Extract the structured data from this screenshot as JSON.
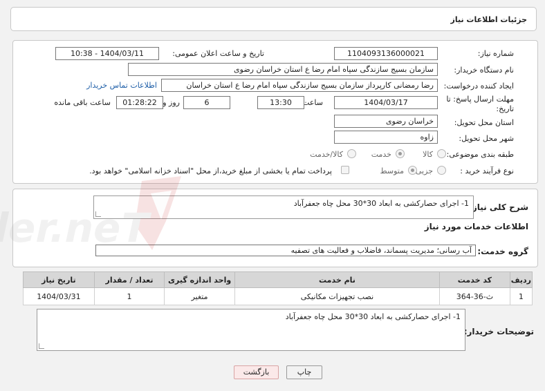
{
  "header": {
    "title": "جزئیات اطلاعات نیاز"
  },
  "form": {
    "need_number": {
      "label": "شماره نیاز:",
      "value": "1104093136000021"
    },
    "announce": {
      "label": "تاریخ و ساعت اعلان عمومی:",
      "value": "1404/03/11 - 10:38"
    },
    "buyer_org": {
      "label": "نام دستگاه خریدار:",
      "value": "سازمان بسیج سازندگی سپاه امام رضا  ع  استان خراسان رضوی"
    },
    "creator": {
      "label": "ایجاد کننده درخواست:",
      "value": "رضا رمضانی کارپرداز سازمان بسیج سازندگی سپاه امام رضا  ع  استان خراسان",
      "contact_link": "اطلاعات تماس خریدار"
    },
    "deadline": {
      "label_line1": "مهلت ارسال پاسخ: تا",
      "label_line2": "تاریخ:",
      "date": "1404/03/17",
      "time_label": "ساعت",
      "time": "13:30",
      "days": "6",
      "days_label": "روز و",
      "remaining": "01:28:22",
      "remaining_label": "ساعت باقی مانده"
    },
    "province": {
      "label": "استان محل تحویل:",
      "value": "خراسان رضوی"
    },
    "city": {
      "label": "شهر محل تحویل:",
      "value": "زاوه"
    },
    "category": {
      "label": "طبقه بندی موضوعی:",
      "options": [
        "کالا",
        "خدمت",
        "کالا/خدمت"
      ],
      "selected": "خدمت"
    },
    "purchase_type": {
      "label": "نوع فرآیند خرید :",
      "options": [
        "جزیی",
        "متوسط"
      ],
      "selected": "متوسط",
      "checkbox_label": "پرداخت تمام یا بخشی از مبلغ خرید،از محل \"اسناد خزانه اسلامی\" خواهد بود."
    }
  },
  "summary": {
    "label": "شرح کلی نیاز:",
    "value": "1-    اجرای حصارکشی به ابعاد 30*30 محل چاه جعفرآباد"
  },
  "services": {
    "title": "اطلاعات خدمات مورد نیاز",
    "group_label": "گروه خدمت:",
    "group_value": "آب رسانی؛ مدیریت پسماند، فاضلاب و فعالیت های تصفیه",
    "columns": [
      "ردیف",
      "کد خدمت",
      "نام خدمت",
      "واحد اندازه گیری",
      "تعداد / مقدار",
      "تاریخ نیاز"
    ],
    "rows": [
      {
        "row": "1",
        "code": "ث-36-364",
        "name": "نصب تجهیزات مکانیکی",
        "unit": "متغیر",
        "qty": "1",
        "date": "1404/03/31"
      }
    ]
  },
  "buyer_notes": {
    "label": "توضیحات خریدار:",
    "value": "1-    اجرای حصارکشی به ابعاد 30*30 محل چاه جعفرآباد"
  },
  "buttons": {
    "print": "چاپ",
    "back": "بازگشت"
  },
  "watermark": {
    "text": "AriaTender.neT"
  }
}
